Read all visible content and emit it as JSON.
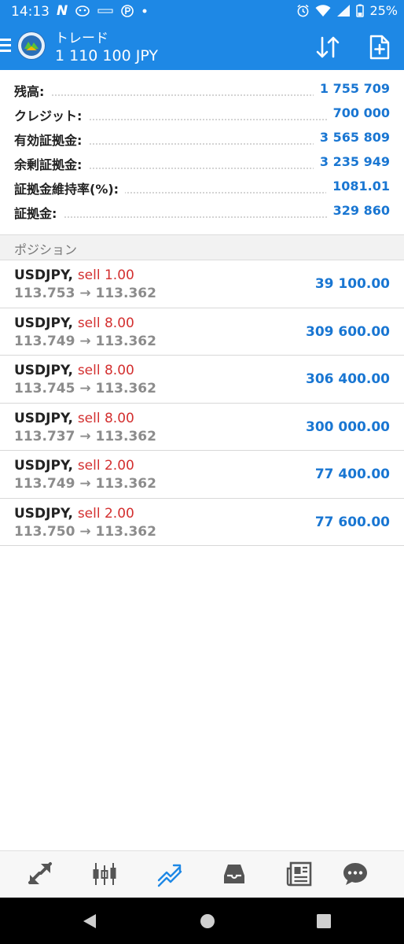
{
  "status_bar": {
    "time": "14:13",
    "battery_percent": "25%",
    "icons_left": [
      "n-icon",
      "face-icon",
      "smb-icon",
      "p-icon",
      "dot-icon"
    ],
    "icons_right": [
      "alarm-icon",
      "wifi-icon",
      "signal-icon",
      "battery-icon"
    ]
  },
  "header": {
    "title": "トレード",
    "balance": "1 110 100 JPY",
    "menu_icon": "hamburger-menu-icon",
    "sort_icon": "sort-arrows-icon",
    "new_order_icon": "new-order-icon",
    "accent_color": "#1e88e5"
  },
  "summary": {
    "rows": [
      {
        "label": "残高:",
        "value": "1 755 709"
      },
      {
        "label": "クレジット:",
        "value": "700 000"
      },
      {
        "label": "有効証拠金:",
        "value": "3 565 809"
      },
      {
        "label": "余剰証拠金:",
        "value": "3 235 949"
      },
      {
        "label": "証拠金維持率(%):",
        "value": "1081.01"
      },
      {
        "label": "証拠金:",
        "value": "329 860"
      }
    ]
  },
  "positions": {
    "section_title": "ポジション",
    "items": [
      {
        "symbol": "USDJPY,",
        "type": "sell 1.00",
        "prices": "113.753 → 113.362",
        "profit": "39 100.00"
      },
      {
        "symbol": "USDJPY,",
        "type": "sell 8.00",
        "prices": "113.749 → 113.362",
        "profit": "309 600.00"
      },
      {
        "symbol": "USDJPY,",
        "type": "sell 8.00",
        "prices": "113.745 → 113.362",
        "profit": "306 400.00"
      },
      {
        "symbol": "USDJPY,",
        "type": "sell 8.00",
        "prices": "113.737 → 113.362",
        "profit": "300 000.00"
      },
      {
        "symbol": "USDJPY,",
        "type": "sell 2.00",
        "prices": "113.749 → 113.362",
        "profit": "77 400.00"
      },
      {
        "symbol": "USDJPY,",
        "type": "sell 2.00",
        "prices": "113.750 → 113.362",
        "profit": "77 600.00"
      }
    ]
  },
  "bottom_nav": {
    "items": [
      {
        "icon": "quotes-icon",
        "active": false
      },
      {
        "icon": "chart-icon",
        "active": false
      },
      {
        "icon": "trade-icon",
        "active": true
      },
      {
        "icon": "history-icon",
        "active": false
      },
      {
        "icon": "news-icon",
        "active": false
      },
      {
        "icon": "chat-icon",
        "active": false
      }
    ],
    "active_color": "#1e88e5",
    "inactive_color": "#555555"
  },
  "system_nav": {
    "buttons": [
      "back-icon",
      "home-icon",
      "recents-icon"
    ]
  }
}
